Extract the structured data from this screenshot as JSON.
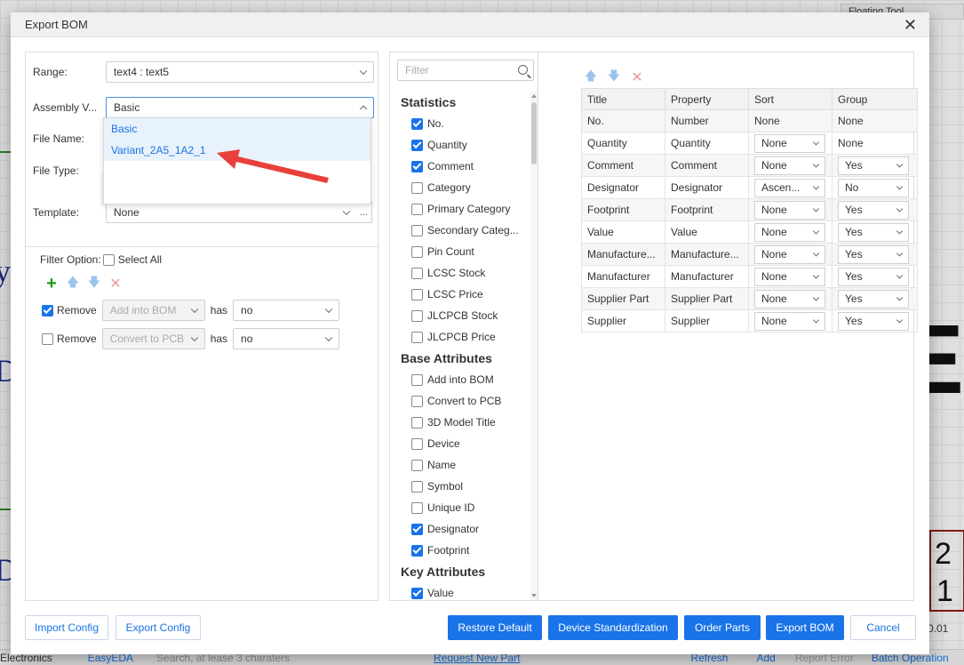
{
  "background": {
    "floating_tool": "Floating Tool",
    "big_letter": "E",
    "num_2": "2",
    "num_1": "1",
    "letter_y": "y",
    "letter_d1": "D",
    "letter_d2": "D",
    "status": {
      "left": "Electronics",
      "tab": "EasyEDA",
      "search_placeholder": "Search, at lease 3 charaters",
      "request": "Request New Part",
      "refresh": "Refresh",
      "add": "Add",
      "report": "Report Error",
      "batch": "Batch Operation",
      "zoom": "0.01"
    }
  },
  "dialog": {
    "title": "Export BOM",
    "form": {
      "range_label": "Range:",
      "range_value": "text4 : text5",
      "assembly_label": "Assembly V...",
      "assembly_value": "Basic",
      "assembly_options": [
        "Basic",
        "Variant_2A5_1A2_1"
      ],
      "file_name_label": "File Name:",
      "file_type_label": "File Type:",
      "template_label": "Template:",
      "template_value": "None",
      "template_more": "..."
    },
    "filter": {
      "label": "Filter Option:",
      "select_all": "Select All",
      "rows": [
        {
          "checked": true,
          "action": "Remove",
          "field": "Add into BOM",
          "op": "has",
          "value": "no"
        },
        {
          "checked": false,
          "action": "Remove",
          "field": "Convert to PCB",
          "op": "has",
          "value": "no"
        }
      ]
    },
    "attributes": {
      "filter_placeholder": "Filter",
      "groups": [
        {
          "name": "Statistics",
          "items": [
            {
              "label": "No.",
              "checked": true
            },
            {
              "label": "Quantity",
              "checked": true
            },
            {
              "label": "Comment",
              "checked": true
            },
            {
              "label": "Category",
              "checked": false
            },
            {
              "label": "Primary Category",
              "checked": false
            },
            {
              "label": "Secondary Categ...",
              "checked": false
            },
            {
              "label": "Pin Count",
              "checked": false
            },
            {
              "label": "LCSC Stock",
              "checked": false
            },
            {
              "label": "LCSC Price",
              "checked": false
            },
            {
              "label": "JLCPCB Stock",
              "checked": false
            },
            {
              "label": "JLCPCB Price",
              "checked": false
            }
          ]
        },
        {
          "name": "Base Attributes",
          "items": [
            {
              "label": "Add into BOM",
              "checked": false
            },
            {
              "label": "Convert to PCB",
              "checked": false
            },
            {
              "label": "3D Model Title",
              "checked": false
            },
            {
              "label": "Device",
              "checked": false
            },
            {
              "label": "Name",
              "checked": false
            },
            {
              "label": "Symbol",
              "checked": false
            },
            {
              "label": "Unique ID",
              "checked": false
            },
            {
              "label": "Designator",
              "checked": true
            },
            {
              "label": "Footprint",
              "checked": true
            }
          ]
        },
        {
          "name": "Key Attributes",
          "items": [
            {
              "label": "Value",
              "checked": true
            }
          ]
        }
      ]
    },
    "move": {
      "right": ">",
      "left": "<"
    },
    "table": {
      "headers": [
        "Title",
        "Property",
        "Sort",
        "Group"
      ],
      "rows": [
        {
          "title": "No.",
          "property": "Number",
          "sort": "None",
          "sort_select": false,
          "group": "None",
          "group_select": false
        },
        {
          "title": "Quantity",
          "property": "Quantity",
          "sort": "None",
          "sort_select": true,
          "group": "None",
          "group_select": false
        },
        {
          "title": "Comment",
          "property": "Comment",
          "sort": "None",
          "sort_select": true,
          "group": "Yes",
          "group_select": true
        },
        {
          "title": "Designator",
          "property": "Designator",
          "sort": "Ascen...",
          "sort_select": true,
          "group": "No",
          "group_select": true
        },
        {
          "title": "Footprint",
          "property": "Footprint",
          "sort": "None",
          "sort_select": true,
          "group": "Yes",
          "group_select": true
        },
        {
          "title": "Value",
          "property": "Value",
          "sort": "None",
          "sort_select": true,
          "group": "Yes",
          "group_select": true
        },
        {
          "title": "Manufacture...",
          "property": "Manufacture...",
          "sort": "None",
          "sort_select": true,
          "group": "Yes",
          "group_select": true
        },
        {
          "title": "Manufacturer",
          "property": "Manufacturer",
          "sort": "None",
          "sort_select": true,
          "group": "Yes",
          "group_select": true
        },
        {
          "title": "Supplier Part",
          "property": "Supplier Part",
          "sort": "None",
          "sort_select": true,
          "group": "Yes",
          "group_select": true
        },
        {
          "title": "Supplier",
          "property": "Supplier",
          "sort": "None",
          "sort_select": true,
          "group": "Yes",
          "group_select": true
        }
      ]
    },
    "footer": {
      "import_config": "Import Config",
      "export_config": "Export Config",
      "restore_default": "Restore Default",
      "device_standardization": "Device Standardization",
      "order_parts": "Order Parts",
      "export_bom": "Export BOM",
      "cancel": "Cancel"
    },
    "colors": {
      "accent": "#1a73e8",
      "arrow": "#e8403a"
    }
  }
}
